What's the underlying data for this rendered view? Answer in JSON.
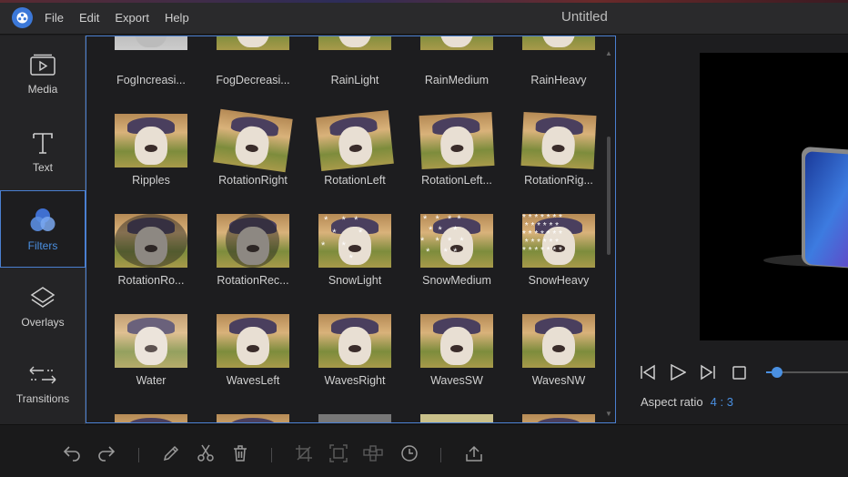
{
  "menu": {
    "file": "File",
    "edit": "Edit",
    "export": "Export",
    "help": "Help"
  },
  "window": {
    "title": "Untitled"
  },
  "sidebar": {
    "items": [
      {
        "label": "Media",
        "icon": "media-icon"
      },
      {
        "label": "Text",
        "icon": "text-icon"
      },
      {
        "label": "Filters",
        "icon": "filters-icon",
        "active": true
      },
      {
        "label": "Overlays",
        "icon": "overlays-icon"
      },
      {
        "label": "Transitions",
        "icon": "transitions-icon"
      }
    ]
  },
  "filters": {
    "row0": [
      "FogIncreasi...",
      "FogDecreasi...",
      "RainLight",
      "RainMedium",
      "RainHeavy"
    ],
    "row1": [
      "Ripples",
      "RotationRight",
      "RotationLeft",
      "RotationLeft...",
      "RotationRig..."
    ],
    "row2": [
      "RotationRo...",
      "RotationRec...",
      "SnowLight",
      "SnowMedium",
      "SnowHeavy"
    ],
    "row3": [
      "Water",
      "WavesLeft",
      "WavesRight",
      "WavesSW",
      "WavesNW"
    ]
  },
  "preview": {
    "aspect_label": "Aspect ratio",
    "aspect_value": "4 : 3",
    "progress": 0.05
  },
  "colors": {
    "accent": "#4a90e2",
    "background": "#1d1d1f",
    "panel": "#242426"
  },
  "toolbar": {
    "icons": [
      "undo-icon",
      "redo-icon",
      "edit-icon",
      "cut-icon",
      "delete-icon",
      "crop-icon",
      "zoom-icon",
      "mosaic-icon",
      "duration-icon",
      "export-icon"
    ]
  }
}
